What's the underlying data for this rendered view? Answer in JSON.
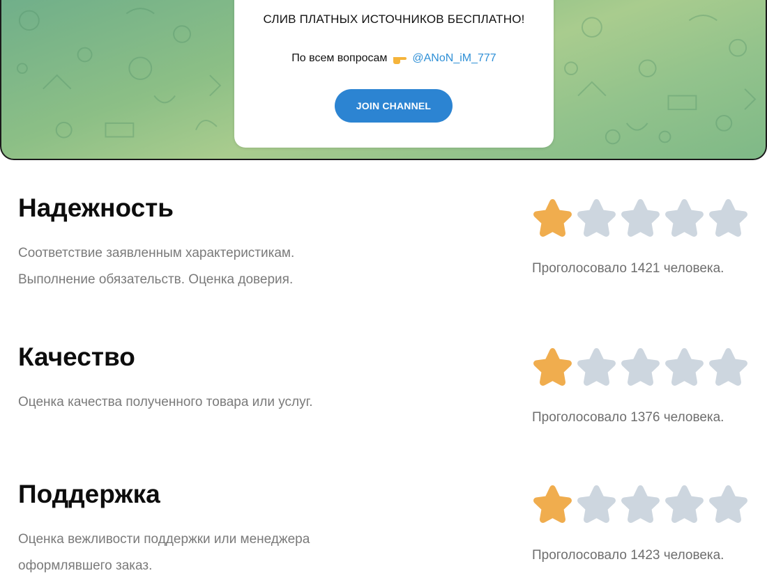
{
  "banner": {
    "headline": "СЛИВ ПЛАТНЫХ ИСТОЧНИКОВ БЕСПЛАТНО!",
    "contact_prefix": "По всем вопросам",
    "contact_icon": "pointing-hand-icon",
    "contact_handle": "@ANoN_iM_777",
    "join_label": "JOIN CHANNEL",
    "button_color": "#2c84d2"
  },
  "ratings": [
    {
      "title": "Надежность",
      "description_lines": [
        "Соответствие заявленным характеристикам.",
        "Выполнение обязательств. Оценка доверия."
      ],
      "stars_filled": 1,
      "stars_total": 5,
      "votes_text": "Проголосовало 1421 человека."
    },
    {
      "title": "Качество",
      "description_lines": [
        "Оценка качества полученного товара или услуг."
      ],
      "stars_filled": 1,
      "stars_total": 5,
      "votes_text": "Проголосовало 1376 человека."
    },
    {
      "title": "Поддержка",
      "description_lines": [
        "Оценка вежливости поддержки или менеджера",
        "оформлявшего заказ."
      ],
      "stars_filled": 1,
      "stars_total": 5,
      "votes_text": "Проголосовало 1423 человека."
    }
  ],
  "colors": {
    "star_filled": "#f0ad4e",
    "star_empty": "#cdd6df",
    "handle_link": "#2e8fd6"
  }
}
